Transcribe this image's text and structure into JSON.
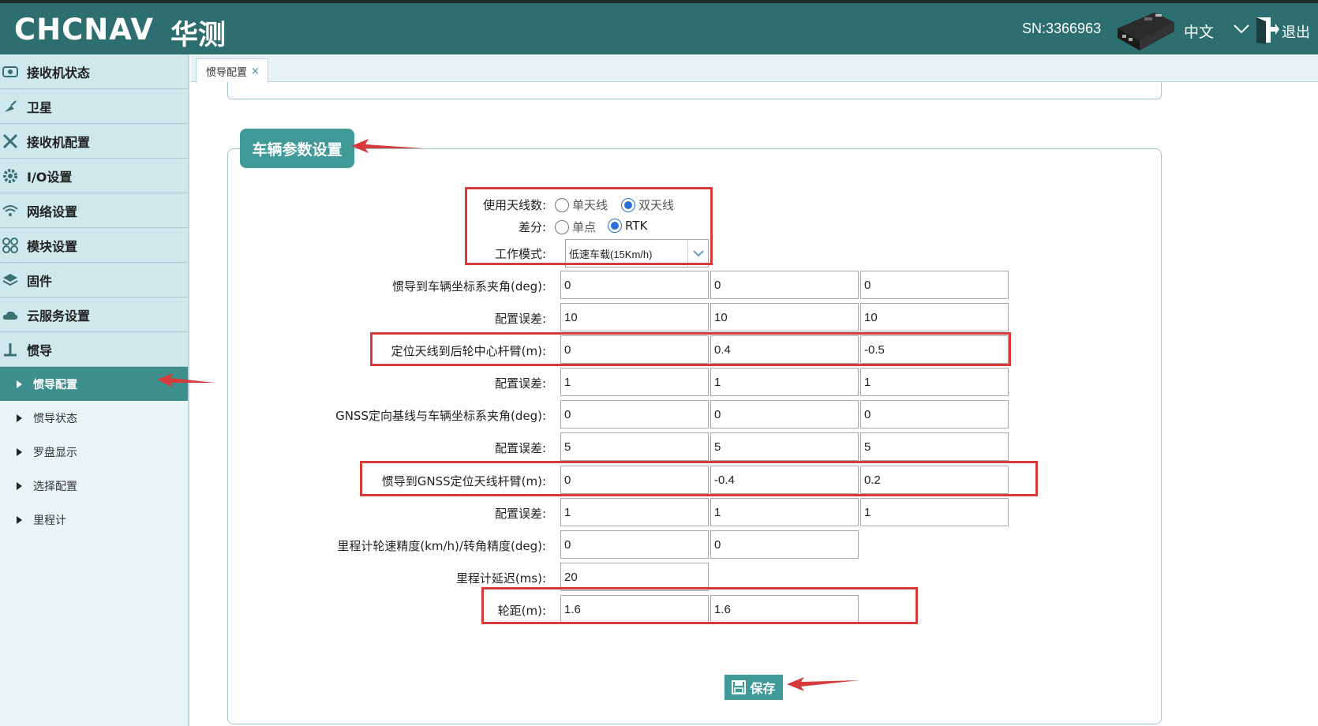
{
  "header": {
    "logo_text": "CHCNAV",
    "logo_cn": "华测",
    "sn": "SN:3366963",
    "lang": "中文",
    "exit": "退出"
  },
  "sidebar": {
    "items": [
      {
        "label": "接收机状态",
        "icon": "monitor-icon"
      },
      {
        "label": "卫星",
        "icon": "satellite-icon"
      },
      {
        "label": "接收机配置",
        "icon": "tools-icon"
      },
      {
        "label": "I/O设置",
        "icon": "gear-icon"
      },
      {
        "label": "网络设置",
        "icon": "wifi-icon"
      },
      {
        "label": "模块设置",
        "icon": "modules-icon"
      },
      {
        "label": "固件",
        "icon": "layers-icon"
      },
      {
        "label": "云服务设置",
        "icon": "cloud-icon"
      },
      {
        "label": "惯导",
        "icon": "ins-icon"
      }
    ],
    "subitems": [
      {
        "label": "惯导配置",
        "active": true
      },
      {
        "label": "惯导状态"
      },
      {
        "label": "罗盘显示"
      },
      {
        "label": "选择配置"
      },
      {
        "label": "里程计"
      }
    ]
  },
  "tab": {
    "label": "惯导配置",
    "close": "×"
  },
  "section_title": "车辆参数设置",
  "form": {
    "antenna_count": {
      "label": "使用天线数:",
      "options": [
        "单天线",
        "双天线"
      ],
      "selected": "双天线"
    },
    "diff": {
      "label": "差分:",
      "options": [
        "单点",
        "RTK"
      ],
      "selected": "RTK"
    },
    "work_mode": {
      "label": "工作模式:",
      "value": "低速车载(15Km/h)"
    },
    "rows": [
      {
        "label": "惯导到车辆坐标系夹角(deg):",
        "values": [
          "0",
          "0",
          "0"
        ]
      },
      {
        "label": "配置误差:",
        "values": [
          "10",
          "10",
          "10"
        ]
      },
      {
        "label": "定位天线到后轮中心杆臂(m):",
        "values": [
          "0",
          "0.4",
          "-0.5"
        ]
      },
      {
        "label": "配置误差:",
        "values": [
          "1",
          "1",
          "1"
        ]
      },
      {
        "label": "GNSS定向基线与车辆坐标系夹角(deg):",
        "values": [
          "0",
          "0",
          "0"
        ]
      },
      {
        "label": "配置误差:",
        "values": [
          "5",
          "5",
          "5"
        ]
      },
      {
        "label": "惯导到GNSS定位天线杆臂(m):",
        "values": [
          "0",
          "-0.4",
          "0.2"
        ]
      },
      {
        "label": "配置误差:",
        "values": [
          "1",
          "1",
          "1"
        ]
      },
      {
        "label": "里程计轮速精度(km/h)/转角精度(deg):",
        "values": [
          "0",
          "0"
        ]
      },
      {
        "label": "里程计延迟(ms):",
        "values": [
          "20"
        ]
      },
      {
        "label": "轮距(m):",
        "values": [
          "1.6",
          "1.6"
        ]
      }
    ]
  },
  "save_label": "保存",
  "colors": {
    "header": "#2d6e70",
    "accent": "#3f9a98",
    "annotation": "#d63a3a"
  }
}
